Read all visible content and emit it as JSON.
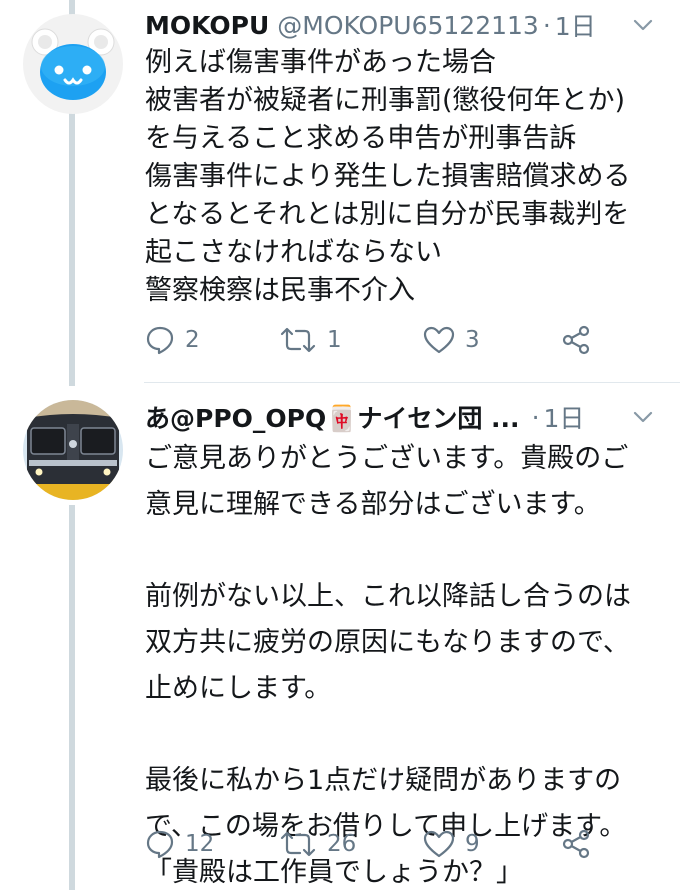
{
  "tweets": [
    {
      "display_name": "MOKOPU",
      "handle": "@MOKOPU65122113",
      "separator": "·",
      "time": "1日",
      "lines": [
        "例えば傷害事件があった場合",
        "被害者が被疑者に刑事罰(懲役何年とか)",
        "を与えること求める申告が刑事告訴",
        "傷害事件により発生した損害賠償求める",
        "となるとそれとは別に自分が民事裁判を",
        "起こさなければならない",
        "警察検察は民事不介入"
      ],
      "reply_count": "2",
      "retweet_count": "1",
      "like_count": "3",
      "avatar_icon": "bear-face-icon"
    },
    {
      "display_name": "あ@PPO_OPQ🀄ナイセン団 ...",
      "separator": "·",
      "time": "1日",
      "lines": [
        "ご意見ありがとうございます。貴殿のご",
        "意見に理解できる部分はございます。",
        "",
        "前例がない以上、これ以降話し合うのは",
        "双方共に疲労の原因にもなりますので、",
        "止めにします。",
        "",
        "最後に私から1点だけ疑問がありますの",
        "で、この場をお借りして申し上げます。",
        "「貴殿は工作員でしょうか？」"
      ],
      "reply_count": "12",
      "retweet_count": "26",
      "like_count": "9",
      "avatar_icon": "train-icon"
    }
  ],
  "icons": {
    "reply": "reply-icon",
    "retweet": "retweet-icon",
    "like": "heart-icon",
    "share": "share-icon",
    "menu": "chevron-down-icon"
  },
  "colors": {
    "text": "#14171a",
    "secondary": "#657786",
    "thread_line": "#cfd9de",
    "avatar_blue": "#1da1f2"
  }
}
